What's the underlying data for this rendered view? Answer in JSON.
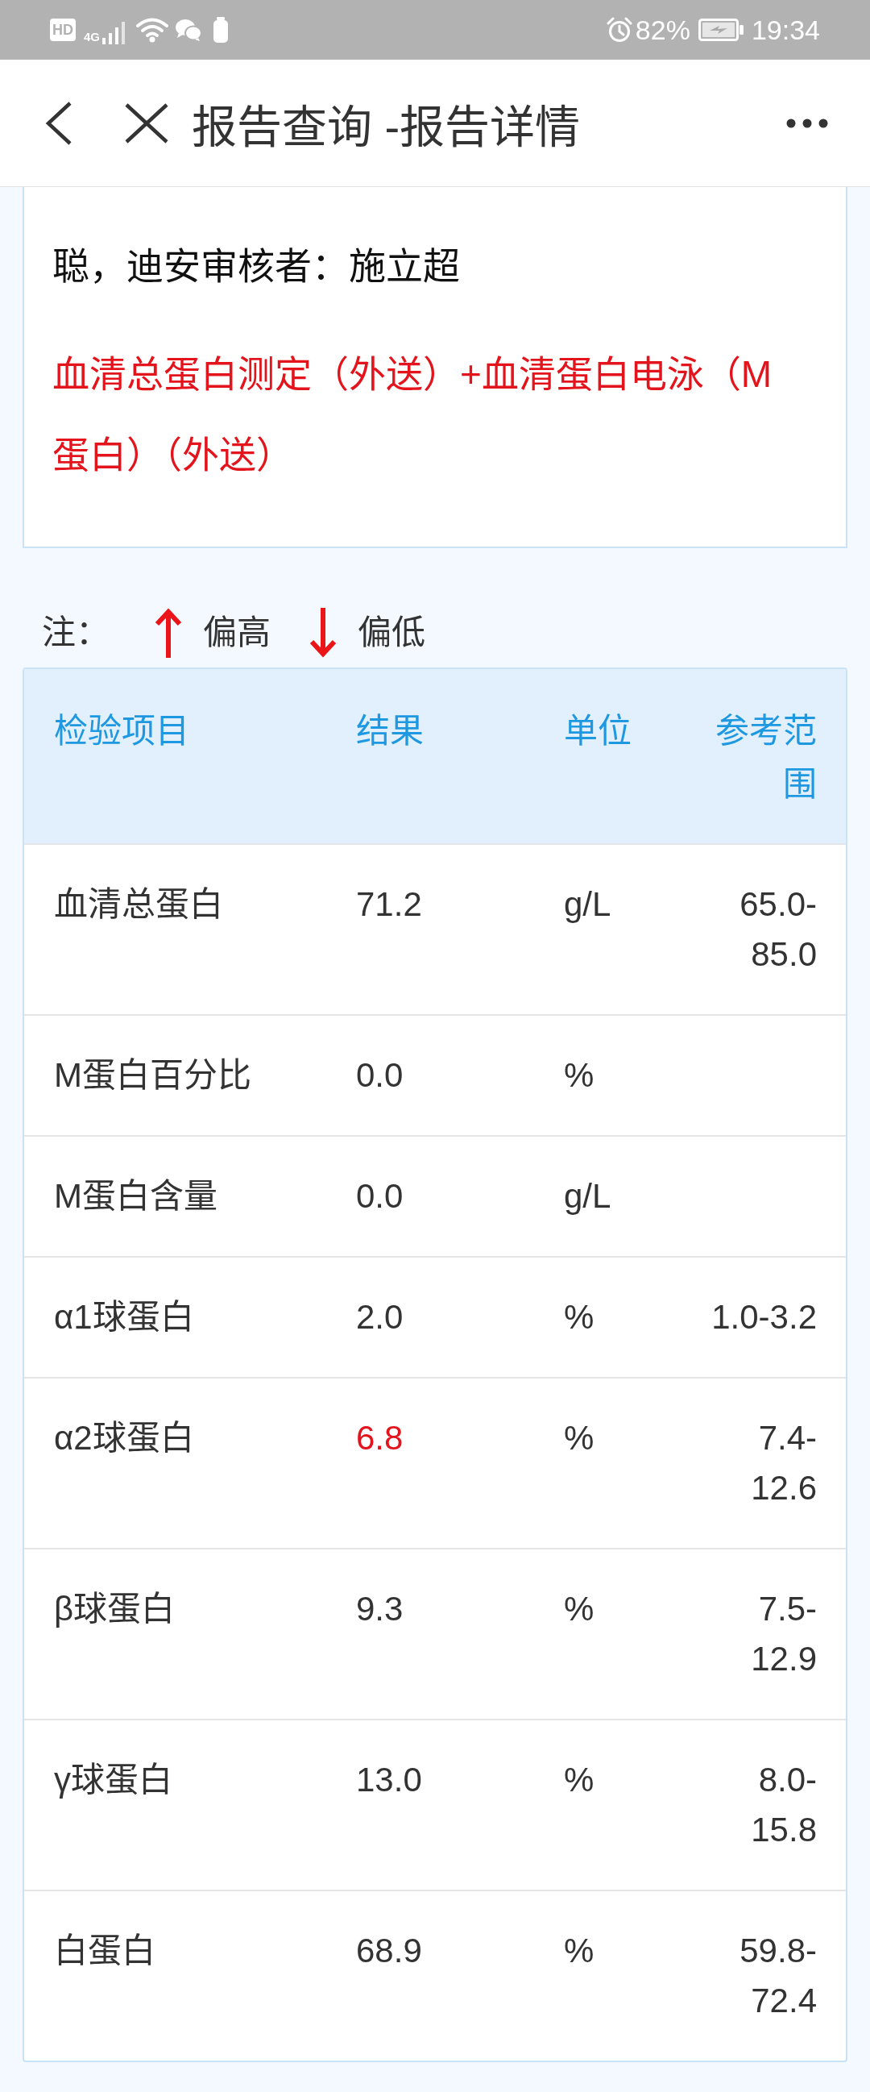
{
  "status_bar": {
    "hd_badge": "HD",
    "network_type": "4G",
    "battery_percent": "82%",
    "time": "19:34"
  },
  "header": {
    "title": "报告查询 -报告详情"
  },
  "report_card": {
    "lines": [
      {
        "kind": "plain",
        "text": "聪，迪安审核者：施立超"
      },
      {
        "kind": "highlight",
        "text": "血清总蛋白测定（外送）+血清蛋白电泳（M蛋白）（外送）"
      }
    ]
  },
  "legend": {
    "label": "注：",
    "items": [
      {
        "kind": "high",
        "label": "偏高"
      },
      {
        "kind": "low",
        "label": "偏低"
      }
    ]
  },
  "table": {
    "columns": [
      "检验项目",
      "结果",
      "单位",
      "参考范围"
    ],
    "rows": [
      {
        "item": "血清总蛋白",
        "result": "71.2",
        "unit": "g/L",
        "range": "65.0-85.0",
        "abnormal": false
      },
      {
        "item": "M蛋白百分比",
        "result": "0.0",
        "unit": "%",
        "abnormal": false
      },
      {
        "item": "M蛋白含量",
        "result": "0.0",
        "unit": "g/L",
        "abnormal": false
      },
      {
        "item": "α1球蛋白",
        "result": "2.0",
        "unit": "%",
        "range": "1.0-3.2",
        "abnormal": false
      },
      {
        "item": "α2球蛋白",
        "result": "6.8",
        "unit": "%",
        "range": "7.4-12.6",
        "abnormal": true
      },
      {
        "item": "β球蛋白",
        "result": "9.3",
        "unit": "%",
        "range": "7.5-12.9",
        "abnormal": false
      },
      {
        "item": "γ球蛋白",
        "result": "13.0",
        "unit": "%",
        "range": "8.0-15.8",
        "abnormal": false
      },
      {
        "item": "白蛋白",
        "result": "68.9",
        "unit": "%",
        "range": "59.8-72.4",
        "abnormal": false
      }
    ]
  }
}
